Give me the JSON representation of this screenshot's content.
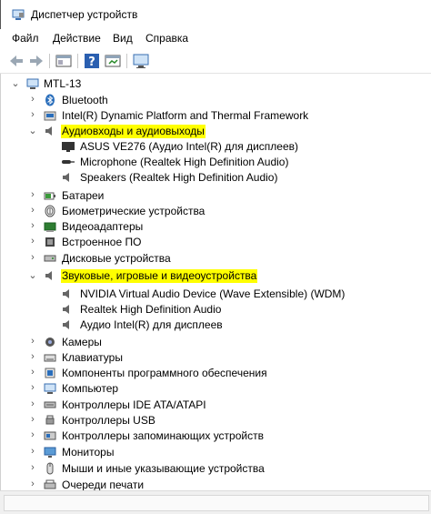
{
  "window": {
    "title": "Диспетчер устройств"
  },
  "menu": [
    "Файл",
    "Действие",
    "Вид",
    "Справка"
  ],
  "toolbar": {
    "buttons": [
      "back-icon",
      "forward-icon",
      "properties-icon",
      "help-icon",
      "update-driver-icon",
      "monitor-scan-icon"
    ]
  },
  "colors": {
    "highlight": "#ffff00",
    "icon_blue": "#2a6ebb"
  },
  "tree": {
    "root": "MTL-13",
    "items": [
      {
        "label": "Bluetooth",
        "icon": "bluetooth-icon",
        "expanded": false,
        "highlight": false
      },
      {
        "label": "Intel(R) Dynamic Platform and Thermal Framework",
        "icon": "device-icon",
        "expanded": false,
        "highlight": false
      },
      {
        "label": "Аудиовходы и аудиовыходы",
        "icon": "speaker-icon",
        "expanded": true,
        "highlight": true,
        "children": [
          {
            "label": "ASUS VE276 (Аудио Intel(R) для дисплеев)",
            "icon": "display-audio-icon"
          },
          {
            "label": "Microphone (Realtek High Definition Audio)",
            "icon": "microphone-icon"
          },
          {
            "label": "Speakers (Realtek High Definition Audio)",
            "icon": "speaker-icon"
          }
        ]
      },
      {
        "label": "Батареи",
        "icon": "battery-icon",
        "expanded": false,
        "highlight": false
      },
      {
        "label": "Биометрические устройства",
        "icon": "biometric-icon",
        "expanded": false,
        "highlight": false
      },
      {
        "label": "Видеоадаптеры",
        "icon": "display-adapter-icon",
        "expanded": false,
        "highlight": false
      },
      {
        "label": "Встроенное ПО",
        "icon": "firmware-icon",
        "expanded": false,
        "highlight": false
      },
      {
        "label": "Дисковые устройства",
        "icon": "disk-icon",
        "expanded": false,
        "highlight": false
      },
      {
        "label": "Звуковые, игровые и видеоустройства",
        "icon": "speaker-icon",
        "expanded": true,
        "highlight": true,
        "children": [
          {
            "label": "NVIDIA Virtual Audio Device (Wave Extensible) (WDM)",
            "icon": "speaker-icon"
          },
          {
            "label": "Realtek High Definition Audio",
            "icon": "speaker-icon"
          },
          {
            "label": "Аудио Intel(R) для дисплеев",
            "icon": "speaker-icon"
          }
        ]
      },
      {
        "label": "Камеры",
        "icon": "camera-icon",
        "expanded": false,
        "highlight": false
      },
      {
        "label": "Клавиатуры",
        "icon": "keyboard-icon",
        "expanded": false,
        "highlight": false
      },
      {
        "label": "Компоненты программного обеспечения",
        "icon": "software-component-icon",
        "expanded": false,
        "highlight": false
      },
      {
        "label": "Компьютер",
        "icon": "computer-icon",
        "expanded": false,
        "highlight": false
      },
      {
        "label": "Контроллеры IDE ATA/ATAPI",
        "icon": "ide-controller-icon",
        "expanded": false,
        "highlight": false
      },
      {
        "label": "Контроллеры USB",
        "icon": "usb-icon",
        "expanded": false,
        "highlight": false
      },
      {
        "label": "Контроллеры запоминающих устройств",
        "icon": "storage-controller-icon",
        "expanded": false,
        "highlight": false
      },
      {
        "label": "Мониторы",
        "icon": "monitor-icon",
        "expanded": false,
        "highlight": false
      },
      {
        "label": "Мыши и иные указывающие устройства",
        "icon": "mouse-icon",
        "expanded": false,
        "highlight": false
      },
      {
        "label": "Очереди печати",
        "icon": "print-queue-icon",
        "expanded": false,
        "highlight": false
      }
    ]
  }
}
